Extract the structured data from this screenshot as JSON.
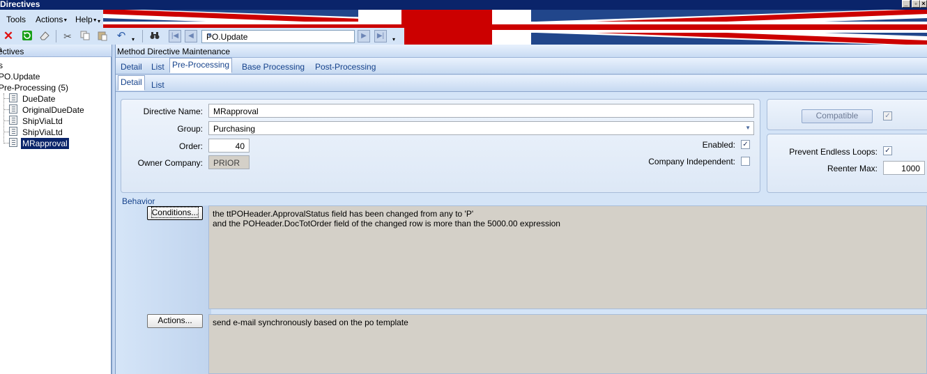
{
  "window": {
    "title": "Directives"
  },
  "menu": {
    "tools": "Tools",
    "actions": "Actions",
    "help": "Help"
  },
  "toolbar": {
    "icons": [
      "delete-icon",
      "refresh-icon",
      "clear-icon",
      "cut-icon",
      "copy-icon",
      "paste-icon",
      "undo-icon",
      "binoculars-icon",
      "first-record-icon",
      "prev-record-icon",
      "next-record-icon",
      "last-record-icon"
    ],
    "method_combo_value": "PO.Update"
  },
  "left_panel": {
    "header": "ectives",
    "tree": [
      {
        "label": "s"
      },
      {
        "label": "PO.Update"
      },
      {
        "label": "Pre-Processing (5)"
      },
      {
        "label": "DueDate"
      },
      {
        "label": "OriginalDueDate"
      },
      {
        "label": "ShipViaLtd"
      },
      {
        "label": "ShipViaLtd"
      },
      {
        "label": "MRapproval",
        "selected": true
      }
    ]
  },
  "main": {
    "header": "Method Directive Maintenance",
    "tabs": [
      "Detail",
      "List",
      "Pre-Processing",
      "Base Processing",
      "Post-Processing"
    ],
    "active_tab": "Pre-Processing",
    "subtabs": [
      "Detail",
      "List"
    ],
    "active_subtab": "Detail"
  },
  "form": {
    "directive_name_label": "Directive Name:",
    "directive_name": "MRapproval",
    "group_label": "Group:",
    "group": "Purchasing",
    "order_label": "Order:",
    "order": "40",
    "owner_company_label": "Owner Company:",
    "owner_company": "PRIOR",
    "enabled_label": "Enabled:",
    "enabled": true,
    "company_independent_label": "Company Independent:",
    "company_independent": false,
    "compatible_button": "Compatible",
    "compatible": true,
    "prevent_loops_label": "Prevent Endless Loops:",
    "prevent_loops": true,
    "reenter_max_label": "Reenter Max:",
    "reenter_max": "1000"
  },
  "behavior": {
    "label": "Behavior",
    "conditions_button": "Conditions...",
    "conditions_text": "the ttPOHeader.ApprovalStatus field has been changed from any to 'P'\nand the POHeader.DocTotOrder field of the changed row is more than the 5000.00 expression",
    "actions_button": "Actions...",
    "actions_text": "send e-mail synchronously based on the po template"
  },
  "colors": {
    "title_bar": "#0a246a",
    "toolbar_bg": "#d4e4f7",
    "tab_text": "#15428b",
    "tree_selected": "#0a246a",
    "delete_red": "#e01010",
    "refresh_green": "#18a018"
  }
}
